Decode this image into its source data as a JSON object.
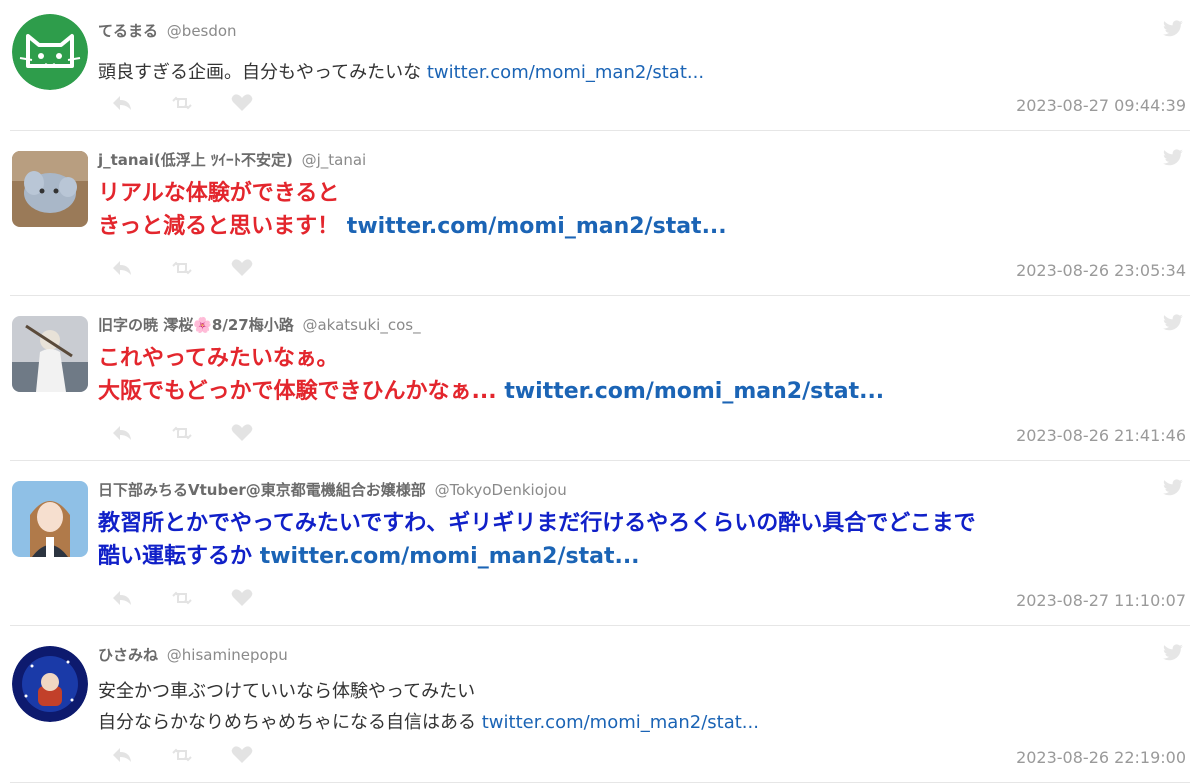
{
  "tweets": [
    {
      "name": "てるまる",
      "handle": "@besdon",
      "lines": [
        "頭良すぎる企画。自分もやってみたいな"
      ],
      "link": "twitter.com/momi_man2/stat...",
      "timestamp": "2023-08-27 09:44:39",
      "avatar": "cat-icon-avatar"
    },
    {
      "name": "j_tanai(低浮上 ﾂｲｰﾄ不安定)",
      "handle": "@j_tanai",
      "lines": [
        "リアルな体験ができると",
        "きっと減ると思います！"
      ],
      "link": "twitter.com/momi_man2/stat...",
      "timestamp": "2023-08-26 23:05:34",
      "avatar": "plush-toy-avatar"
    },
    {
      "name": "旧字の暁 澪桜🌸8/27梅小路",
      "handle": "@akatsuki_cos_",
      "lines": [
        "これやってみたいなぁ。",
        "大阪でもどっかで体験できひんかなぁ..."
      ],
      "link": "twitter.com/momi_man2/stat...",
      "timestamp": "2023-08-26 21:41:46",
      "avatar": "cosplay-photo-avatar"
    },
    {
      "name": "日下部みちるVtuber@東京都電機組合お嬢様部",
      "handle": "@TokyoDenkiojou",
      "lines": [
        "教習所とかでやってみたいですわ、ギリギリまだ行けるやろくらいの酔い具合でどこまで",
        "酷い運転するか"
      ],
      "link": "twitter.com/momi_man2/stat...",
      "timestamp": "2023-08-27 11:10:07",
      "avatar": "vtuber-girl-avatar"
    },
    {
      "name": "ひさみね",
      "handle": "@hisaminepopu",
      "lines": [
        "安全かつ車ぶつけていいなら体験やってみたい",
        "自分ならかなりめちゃめちゃになる自信はある"
      ],
      "link": "twitter.com/momi_man2/stat...",
      "timestamp": "2023-08-26 22:19:00",
      "avatar": "starry-character-avatar"
    }
  ],
  "icons": {
    "reply": "reply-icon",
    "retweet": "retweet-icon",
    "like": "heart-icon",
    "source": "twitter-bird-icon"
  },
  "colors": {
    "link": "#1b64b5",
    "emphasis_red": "#e3262d",
    "emphasis_blue": "#1020c8",
    "meta": "#9a9a9a"
  }
}
